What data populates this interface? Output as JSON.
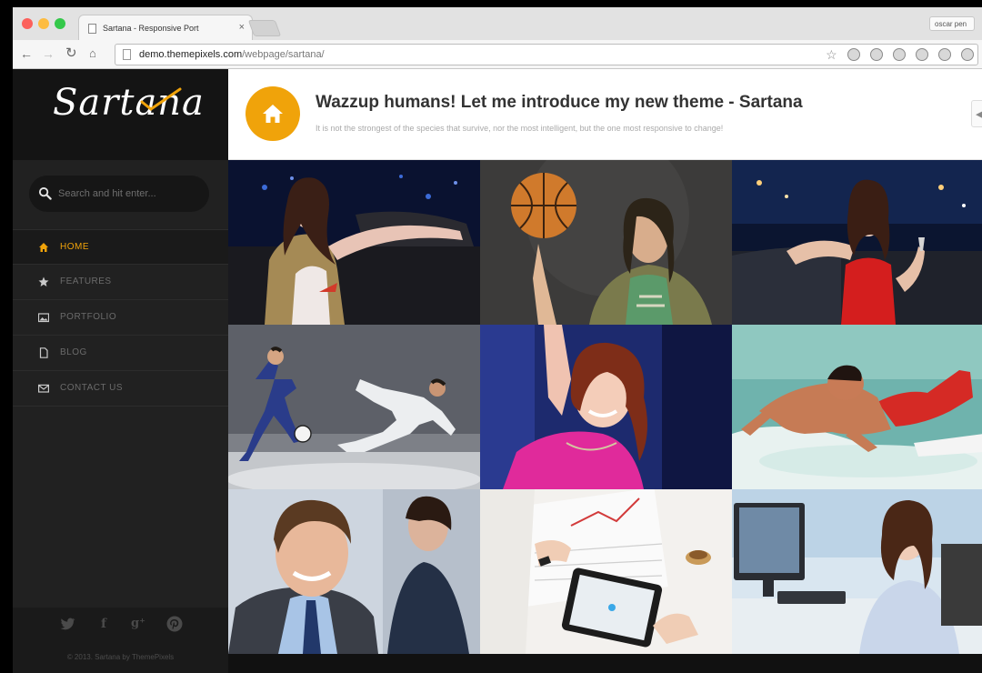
{
  "browser": {
    "tab_title": "Sartana - Responsive Port",
    "tab_close": "×",
    "profile_name": "oscar pen",
    "url_host": "demo.themepixels.com",
    "url_path": "/webpage/sartana/"
  },
  "sidebar": {
    "logo": "Sartana",
    "search_placeholder": "Search and hit enter...",
    "nav": [
      {
        "label": "HOME",
        "icon": "home-icon",
        "active": true
      },
      {
        "label": "FEATURES",
        "icon": "star-icon",
        "active": false
      },
      {
        "label": "PORTFOLIO",
        "icon": "picture-icon",
        "active": false
      },
      {
        "label": "BLOG",
        "icon": "document-icon",
        "active": false
      },
      {
        "label": "CONTACT US",
        "icon": "envelope-icon",
        "active": false
      }
    ],
    "social": {
      "twitter": "twitter-icon",
      "facebook": "f",
      "gplus": "g⁺",
      "pinterest": "pinterest-icon"
    },
    "copyright": "© 2013. Sartana by ThemePixels"
  },
  "header": {
    "title": "Wazzup humans! Let me introduce my new theme - Sartana",
    "subtitle": "It is not the strongest of the species that survive, nor the most intelligent, but the one most responsive to change!"
  },
  "colors": {
    "accent": "#f0a30a",
    "sidebar_bg": "#212121",
    "logo_bg": "#141414",
    "header_text": "#333333"
  },
  "portfolio": [
    {
      "name": "woman-red-drink"
    },
    {
      "name": "man-spinning-basketball"
    },
    {
      "name": "woman-red-dress"
    },
    {
      "name": "soccer-players"
    },
    {
      "name": "smiling-woman-pink"
    },
    {
      "name": "man-swimming-board"
    },
    {
      "name": "smiling-businessman"
    },
    {
      "name": "tablet-charts-desk"
    },
    {
      "name": "woman-at-computer"
    }
  ]
}
